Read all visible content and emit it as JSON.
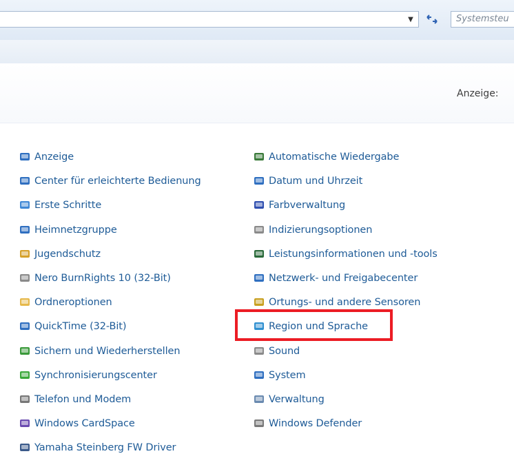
{
  "address_bar": {
    "search_text": "Systemsteu"
  },
  "header": {
    "view_label": "Anzeige:"
  },
  "items_left": [
    {
      "label": "Anzeige",
      "icon": "monitor-icon",
      "color": "#2f6fc0"
    },
    {
      "label": "Center für erleichterte Bedienung",
      "icon": "accessibility-icon",
      "color": "#2f6fc0"
    },
    {
      "label": "Erste Schritte",
      "icon": "getting-started-icon",
      "color": "#3f88d6"
    },
    {
      "label": "Heimnetzgruppe",
      "icon": "homegroup-icon",
      "color": "#2f6fc0"
    },
    {
      "label": "Jugendschutz",
      "icon": "parental-controls-icon",
      "color": "#d6a12a"
    },
    {
      "label": "Nero BurnRights 10 (32-Bit)",
      "icon": "nero-icon",
      "color": "#8a8a8a"
    },
    {
      "label": "Ordneroptionen",
      "icon": "folder-options-icon",
      "color": "#e6b84a"
    },
    {
      "label": "QuickTime (32-Bit)",
      "icon": "quicktime-icon",
      "color": "#2f6fc0"
    },
    {
      "label": "Sichern und Wiederherstellen",
      "icon": "backup-icon",
      "color": "#3a9a3a"
    },
    {
      "label": "Synchronisierungscenter",
      "icon": "sync-center-icon",
      "color": "#3aa83a"
    },
    {
      "label": "Telefon und Modem",
      "icon": "phone-modem-icon",
      "color": "#777777"
    },
    {
      "label": "Windows CardSpace",
      "icon": "cardspace-icon",
      "color": "#6a4bb0"
    },
    {
      "label": "Yamaha Steinberg FW Driver",
      "icon": "yamaha-driver-icon",
      "color": "#3b5a8a"
    }
  ],
  "items_right": [
    {
      "label": "Automatische Wiedergabe",
      "icon": "autoplay-icon",
      "color": "#3a7a3a"
    },
    {
      "label": "Datum und Uhrzeit",
      "icon": "date-time-icon",
      "color": "#2f6fc0"
    },
    {
      "label": "Farbverwaltung",
      "icon": "color-management-icon",
      "color": "#2f4fb0"
    },
    {
      "label": "Indizierungsoptionen",
      "icon": "indexing-options-icon",
      "color": "#8a8a8a"
    },
    {
      "label": "Leistungsinformationen und -tools",
      "icon": "performance-icon",
      "color": "#2a6a3a"
    },
    {
      "label": "Netzwerk- und Freigabecenter",
      "icon": "network-sharing-icon",
      "color": "#2f6fc0"
    },
    {
      "label": "Ortungs- und andere Sensoren",
      "icon": "sensors-icon",
      "color": "#c8a020"
    },
    {
      "label": "Region und Sprache",
      "icon": "region-language-icon",
      "color": "#2f8fd0"
    },
    {
      "label": "Sound",
      "icon": "sound-icon",
      "color": "#8a8a8a"
    },
    {
      "label": "System",
      "icon": "system-icon",
      "color": "#2f6fc0"
    },
    {
      "label": "Verwaltung",
      "icon": "administrative-tools-icon",
      "color": "#6a8ab0"
    },
    {
      "label": "Windows Defender",
      "icon": "windows-defender-icon",
      "color": "#7a7a7a"
    }
  ],
  "highlight": {
    "target": "Region und Sprache",
    "color": "#ec1c24"
  }
}
